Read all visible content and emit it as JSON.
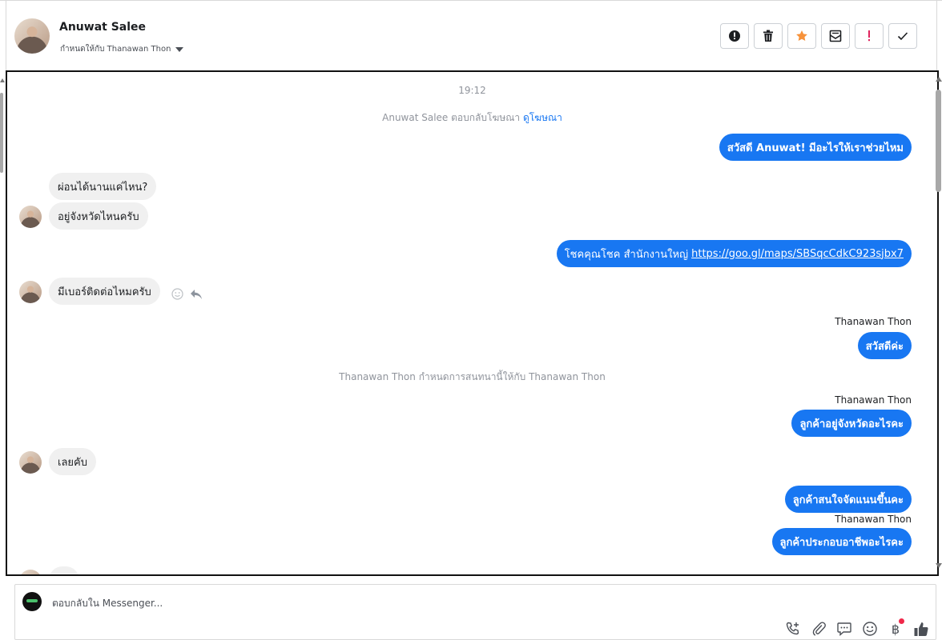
{
  "header": {
    "contact_name": "Anuwat Salee",
    "assigned_text": "กำหนดให้กับ Thanawan Thon",
    "actions": [
      {
        "name": "spam-button",
        "icon": "alert-circle-icon"
      },
      {
        "name": "delete-button",
        "icon": "trash-icon"
      },
      {
        "name": "star-button",
        "icon": "star-icon",
        "color": "#f7923a"
      },
      {
        "name": "mark-unread-button",
        "icon": "envelope-icon"
      },
      {
        "name": "important-button",
        "icon": "exclamation-icon",
        "color": "#e0245e"
      },
      {
        "name": "done-button",
        "icon": "check-icon"
      }
    ]
  },
  "chat": {
    "time": "19:12",
    "ad_reply": {
      "text": "Anuwat Salee ตอบกลับโฆษณา",
      "link": "ดูโฆษณา"
    },
    "assignment_note": "Thanawan Thon กำหนดการสนทนานี้ให้กับ Thanawan Thon",
    "messages": [
      {
        "dir": "out",
        "text": "สวัสดี Anuwat! มีอะไรให้เราช่วยไหม"
      },
      {
        "dir": "in",
        "text": "ผ่อนได้นานแค่ไหน?"
      },
      {
        "dir": "in",
        "text": "อยู่จังหวัดไหนครับ"
      },
      {
        "dir": "out",
        "text": "โชคคุณโชค สำนักงานใหญ่",
        "link": "https://goo.gl/maps/SBSqcCdkC923sjbx7"
      },
      {
        "dir": "in",
        "text": "มีเบอร์ติดต่อไหมครับ"
      },
      {
        "dir": "out",
        "sender": "Thanawan Thon",
        "text": "สวัสดีค่ะ"
      },
      {
        "dir": "out",
        "sender": "Thanawan Thon",
        "text": "ลูกค้าอยู่จังหวัดอะไรคะ"
      },
      {
        "dir": "in",
        "text": "เลยคับ"
      },
      {
        "dir": "out",
        "text": "ลูกค้าสนใจจัดแนนขึ้นคะ"
      },
      {
        "dir": "out",
        "sender": "Thanawan Thon",
        "text": "ลูกค้าประกอบอาชีพอะไรคะ"
      }
    ]
  },
  "composer": {
    "placeholder": "ตอบกลับใน Messenger...",
    "tools": [
      "phone-add-icon",
      "paperclip-icon",
      "speech-bubble-icon",
      "emoji-icon",
      "baht-icon",
      "thumbs-up-icon"
    ],
    "baht_symbol": "฿"
  }
}
